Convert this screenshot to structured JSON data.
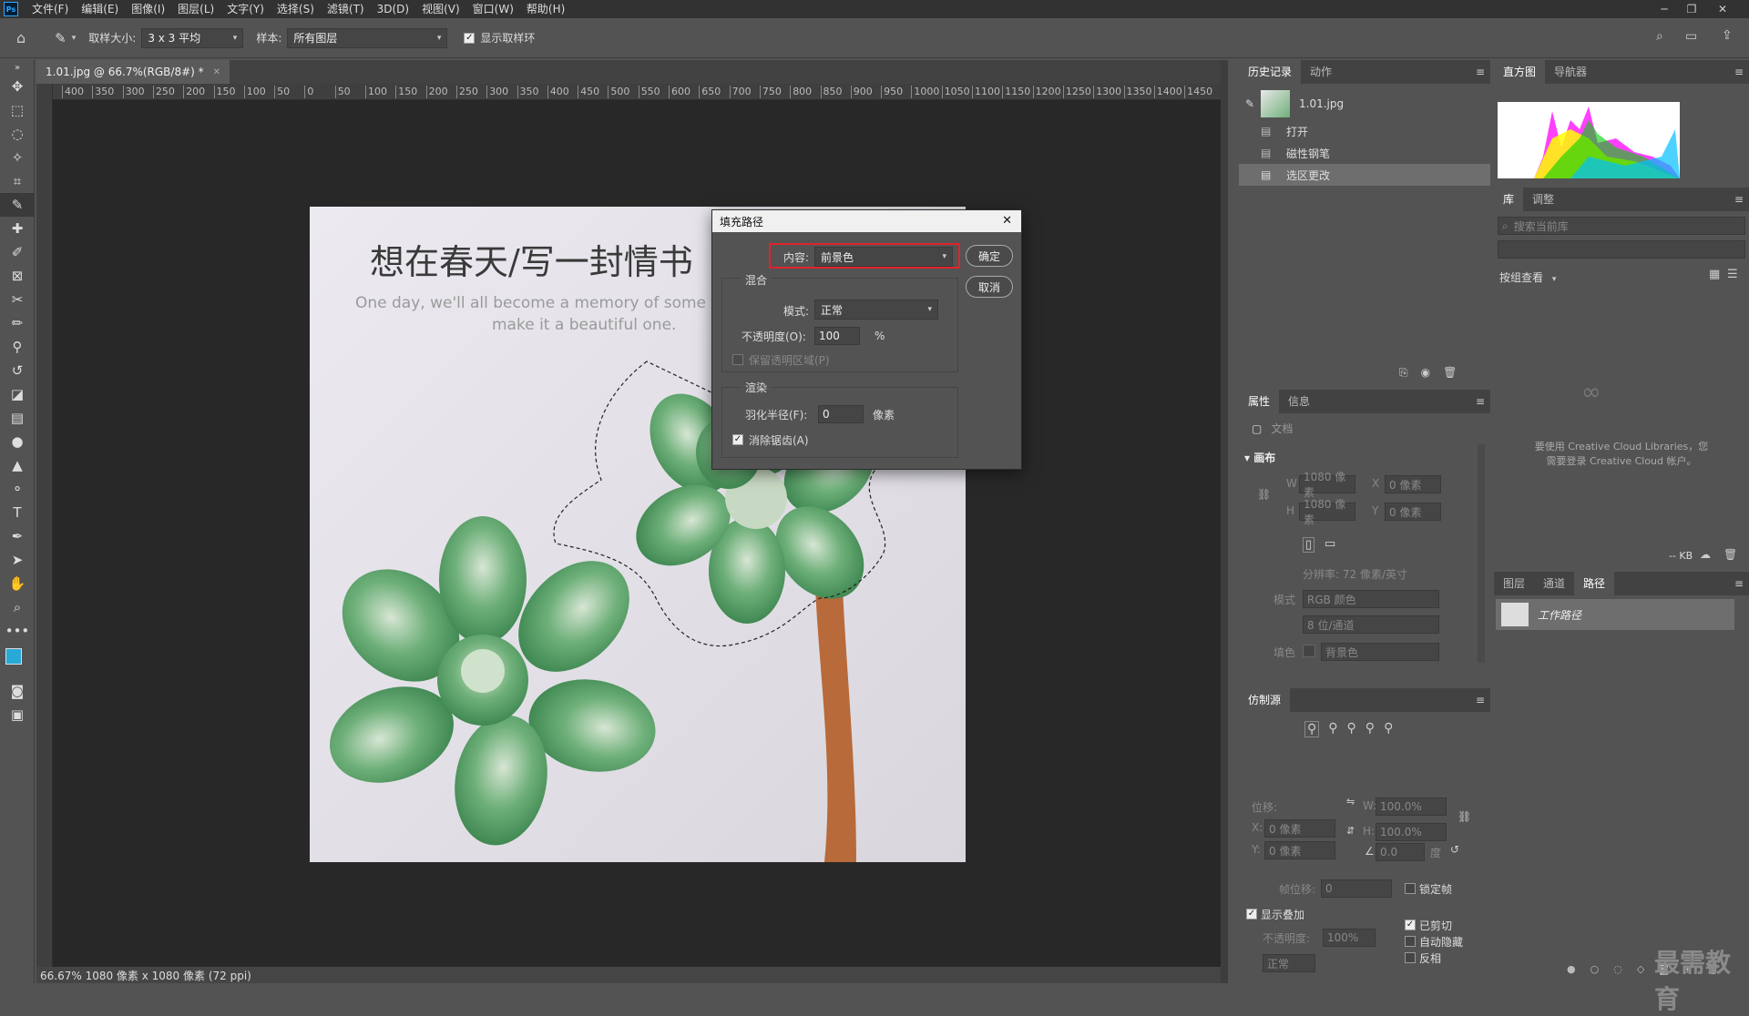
{
  "app": {
    "logo": "Ps"
  },
  "menu": [
    "文件(F)",
    "编辑(E)",
    "图像(I)",
    "图层(L)",
    "文字(Y)",
    "选择(S)",
    "滤镜(T)",
    "3D(D)",
    "视图(V)",
    "窗口(W)",
    "帮助(H)"
  ],
  "options": {
    "sample_size_label": "取样大小:",
    "sample_size_value": "3 x 3 平均",
    "sample_label": "样本:",
    "sample_value": "所有图层",
    "show_ring_label": "显示取样环"
  },
  "document": {
    "tab_title": "1.01.jpg @ 66.7%(RGB/8#) *",
    "ruler_ticks": [
      "400",
      "350",
      "300",
      "250",
      "200",
      "150",
      "100",
      "50",
      "0",
      "50",
      "100",
      "150",
      "200",
      "250",
      "300",
      "350",
      "400",
      "450",
      "500",
      "550",
      "600",
      "650",
      "700",
      "750",
      "800",
      "850",
      "900",
      "950",
      "1000",
      "1050",
      "1100",
      "1150",
      "1200",
      "1250",
      "1300",
      "1350",
      "1400",
      "1450"
    ],
    "image_heading": "想在春天/写一封情书",
    "image_sub_1": "One day, we'll all become a memory of some",
    "image_sub_2": "make it a beautiful one.",
    "status": "66.67%  1080 像素 x 1080 像素 (72 ppi)"
  },
  "history_panel": {
    "tabs": [
      "历史记录",
      "动作"
    ],
    "snapshot": "1.01.jpg",
    "items": [
      "打开",
      "磁性钢笔",
      "选区更改"
    ]
  },
  "histogram_panel": {
    "tabs": [
      "直方图",
      "导航器"
    ]
  },
  "library_panel": {
    "tabs": [
      "库",
      "调整"
    ],
    "search_placeholder": "搜索当前库",
    "view_label": "按组查看",
    "message_1": "要使用 Creative Cloud Libraries，您",
    "message_2": "需要登录 Creative Cloud 帐户。",
    "size": "-- KB"
  },
  "properties_panel": {
    "tabs": [
      "属性",
      "信息"
    ],
    "doc_label": "文档",
    "canvas_label": "画布",
    "w_label": "W",
    "w_value": "1080 像素",
    "h_label": "H",
    "h_value": "1080 像素",
    "x_label": "X",
    "x_value": "0 像素",
    "y_label": "Y",
    "y_value": "0 像素",
    "resolution": "分辨率: 72 像素/英寸",
    "mode_label": "模式",
    "mode_value": "RGB 颜色",
    "depth_value": "8 位/通道",
    "fill_label": "填色",
    "fill_value": "背景色"
  },
  "layers_panel": {
    "tabs": [
      "图层",
      "通道",
      "路径"
    ],
    "path_name": "工作路径"
  },
  "clone_panel": {
    "title": "仿制源",
    "offset_label": "位移:",
    "x_label": "X:",
    "x_value": "0 像素",
    "y_label": "Y:",
    "y_value": "0 像素",
    "w_label": "W:",
    "w_value": "100.0%",
    "h_label": "H:",
    "h_value": "100.0%",
    "angle_value": "0.0",
    "angle_unit": "度",
    "frame_offset_label": "帧位移:",
    "frame_offset_value": "0",
    "lock_frame_label": "锁定帧",
    "show_overlay_label": "显示叠加",
    "opacity_label": "不透明度:",
    "opacity_value": "100%",
    "clipped_label": "已剪切",
    "auto_hide_label": "自动隐藏",
    "invert_label": "反相",
    "blend_value": "正常"
  },
  "dialog": {
    "title": "填充路径",
    "content_label": "内容:",
    "content_value": "前景色",
    "ok_label": "确定",
    "cancel_label": "取消",
    "blend_group": "混合",
    "mode_label": "模式:",
    "mode_value": "正常",
    "opacity_label": "不透明度(O):",
    "opacity_value": "100",
    "opacity_unit": "%",
    "preserve_label": "保留透明区域(P)",
    "render_group": "渲染",
    "feather_label": "羽化半径(F):",
    "feather_value": "0",
    "feather_unit": "像素",
    "antialias_label": "消除锯齿(A)"
  },
  "watermark": "最需教育",
  "colors": {
    "accent": "#31a8ff",
    "foreground": "#29a9d6",
    "highlight_box": "#e0242a"
  }
}
